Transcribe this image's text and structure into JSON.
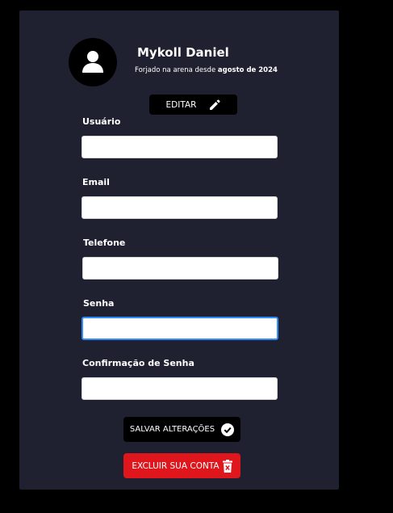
{
  "profile": {
    "name": "Mykoll Daniel",
    "since_prefix": "Forjado na arena desde ",
    "since_date": "agosto de 2024"
  },
  "actions": {
    "edit_label": "EDITAR",
    "save_label": "SALVAR ALTERAÇÕES",
    "delete_label": "EXCLUIR SUA CONTA"
  },
  "fields": [
    {
      "label": "Usuário",
      "value": ""
    },
    {
      "label": "Email",
      "value": ""
    },
    {
      "label": "Telefone",
      "value": ""
    },
    {
      "label": "Senha",
      "value": ""
    },
    {
      "label": "Confirmação de Senha",
      "value": ""
    }
  ],
  "colors": {
    "card_bg": "#1f2030",
    "page_bg": "#000000",
    "delete_red": "#e0161d",
    "focus_blue": "#2f8cff"
  },
  "icons": {
    "avatar": "user-icon",
    "edit": "pencil-icon",
    "save": "check-circle-icon",
    "delete": "trash-icon"
  }
}
